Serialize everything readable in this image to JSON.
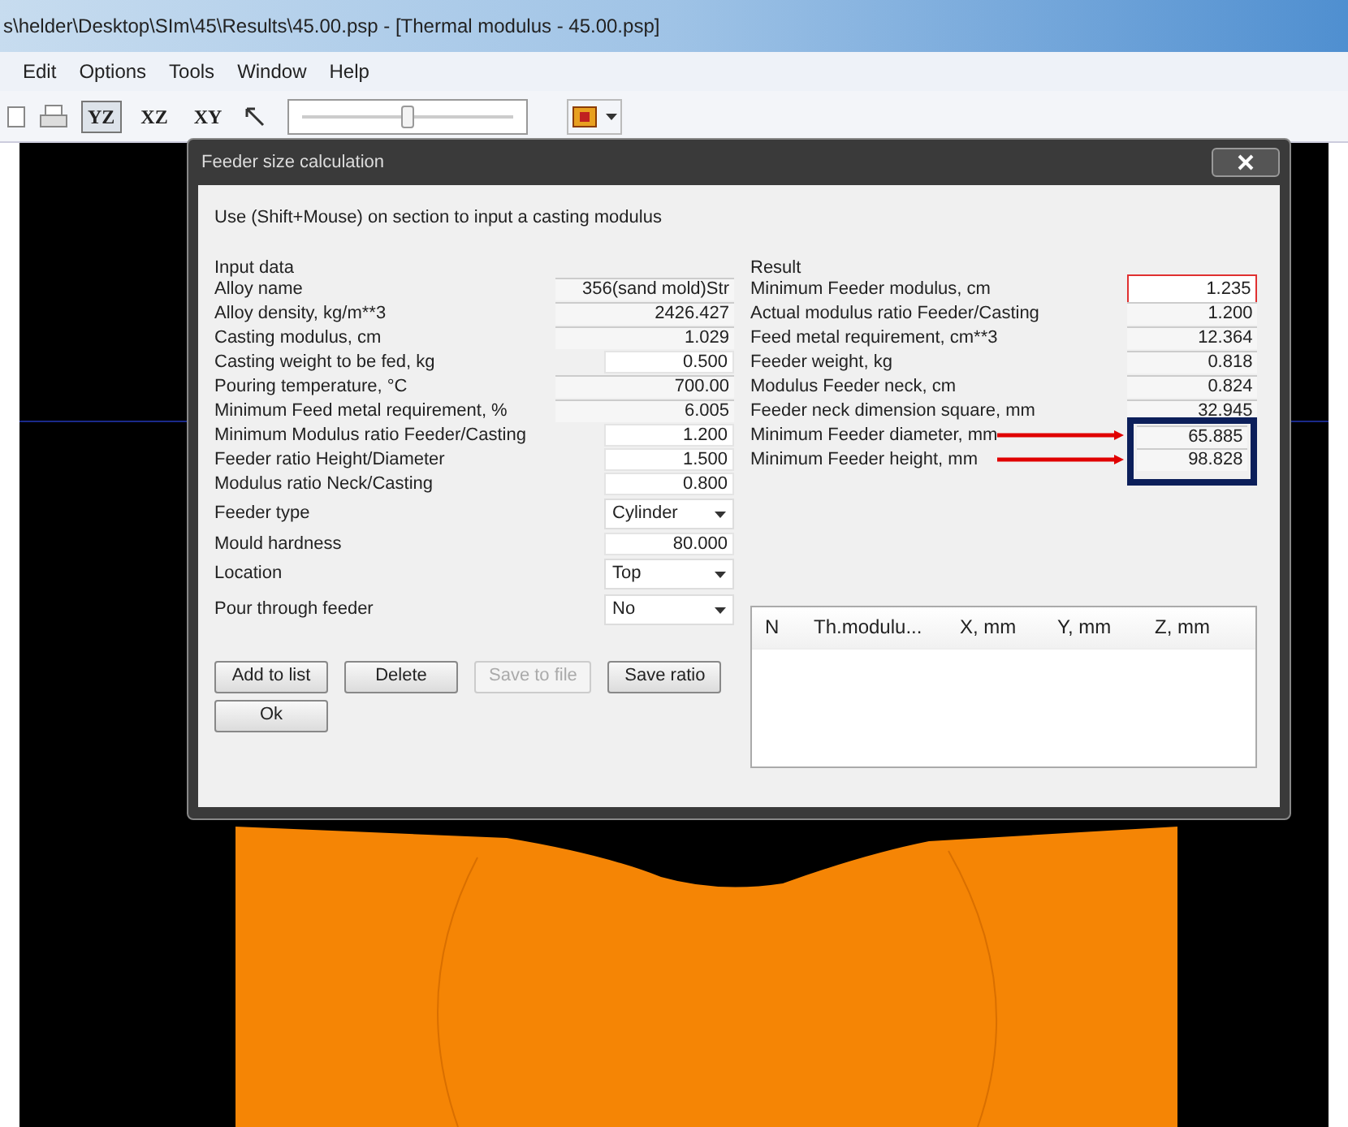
{
  "window": {
    "title": "s\\helder\\Desktop\\SIm\\45\\Results\\45.00.psp - [Thermal modulus - 45.00.psp]"
  },
  "menu": [
    "Edit",
    "Options",
    "Tools",
    "Window",
    "Help"
  ],
  "toolbar": {
    "views": [
      {
        "label": "YZ",
        "selected": true
      },
      {
        "label": "XZ",
        "selected": false
      },
      {
        "label": "XY",
        "selected": false
      }
    ],
    "slider": {
      "level": 0.5
    }
  },
  "dialog": {
    "title": "Feeder size calculation",
    "hint": "Use (Shift+Mouse) on section to input a casting modulus",
    "input": {
      "title": "Input data",
      "rows": [
        {
          "label": "Alloy name",
          "value": "356(sand mold)Str",
          "kind": "readonly"
        },
        {
          "label": "Alloy density, kg/m**3",
          "value": "2426.427",
          "kind": "readonly"
        },
        {
          "label": "Casting modulus, cm",
          "value": "1.029",
          "kind": "readonly"
        },
        {
          "label": "Casting weight to be fed, kg",
          "value": "0.500",
          "kind": "edit"
        },
        {
          "label": "Pouring temperature, °C",
          "value": "700.00",
          "kind": "readonly"
        },
        {
          "label": "Minimum Feed metal requirement, %",
          "value": "6.005",
          "kind": "readonly"
        },
        {
          "label": "Minimum Modulus ratio Feeder/Casting",
          "value": "1.200",
          "kind": "edit"
        },
        {
          "label": "Feeder ratio Height/Diameter",
          "value": "1.500",
          "kind": "edit"
        },
        {
          "label": "Modulus ratio Neck/Casting",
          "value": "0.800",
          "kind": "edit"
        },
        {
          "label": "Feeder type",
          "value": "Cylinder",
          "kind": "dropdown"
        },
        {
          "label": "Mould hardness",
          "value": "80.000",
          "kind": "edit"
        },
        {
          "label": "Location",
          "value": "Top",
          "kind": "dropdown"
        },
        {
          "label": "Pour through feeder",
          "value": "No",
          "kind": "dropdown"
        }
      ]
    },
    "result": {
      "title": "Result",
      "rows": [
        {
          "label": "Minimum Feeder modulus, cm",
          "value": "1.235",
          "highlighted": true,
          "arrow": false,
          "boxed": false
        },
        {
          "label": "Actual modulus ratio Feeder/Casting",
          "value": "1.200",
          "highlighted": false,
          "arrow": false,
          "boxed": false
        },
        {
          "label": "Feed metal requirement, cm**3",
          "value": "12.364",
          "highlighted": false,
          "arrow": false,
          "boxed": false
        },
        {
          "label": "Feeder weight, kg",
          "value": "0.818",
          "highlighted": false,
          "arrow": false,
          "boxed": false
        },
        {
          "label": "Modulus Feeder neck, cm",
          "value": "0.824",
          "highlighted": false,
          "arrow": false,
          "boxed": false
        },
        {
          "label": "Feeder neck dimension square, mm",
          "value": "32.945",
          "highlighted": false,
          "arrow": false,
          "boxed": false
        },
        {
          "label": "Minimum Feeder diameter, mm",
          "value": "65.885",
          "highlighted": false,
          "arrow": true,
          "boxed": true
        },
        {
          "label": "Minimum Feeder height, mm",
          "value": "98.828",
          "highlighted": false,
          "arrow": true,
          "boxed": true
        }
      ]
    },
    "table": {
      "columns": [
        "N",
        "Th.modulu...",
        "X, mm",
        "Y, mm",
        "Z, mm"
      ]
    },
    "buttons": [
      {
        "label": "Add to list",
        "disabled": false
      },
      {
        "label": "Delete",
        "disabled": false
      },
      {
        "label": "Save to file",
        "disabled": true
      },
      {
        "label": "Save ratio",
        "disabled": false
      },
      {
        "label": "Ok",
        "disabled": false
      }
    ]
  }
}
